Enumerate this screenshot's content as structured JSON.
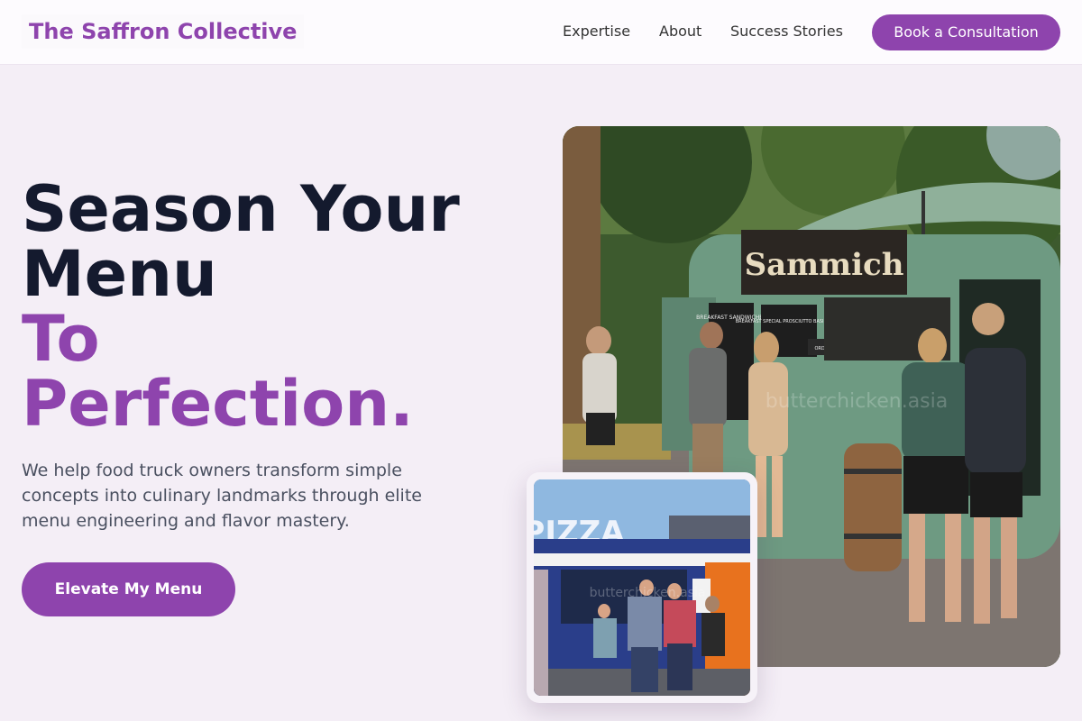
{
  "header": {
    "brand": "The Saffron Collective",
    "nav": [
      "Expertise",
      "About",
      "Success Stories"
    ],
    "cta": "Book a Consultation"
  },
  "hero": {
    "headline_line1": "Season Your",
    "headline_line2": "Menu",
    "headline_line3": "To",
    "headline_line4": "Perfection.",
    "subtext": "We help food truck owners transform simple concepts into culinary landmarks through elite menu engineering and flavor mastery.",
    "cta": "Elevate My Menu"
  },
  "images": {
    "main_sign": "Sammich",
    "main_board1": "BREAKFAST SANDWICHES",
    "main_board2": "BREAKFAST SPECIAL PROSCIUTTO BASIL PESTO",
    "main_board3": "ORDER HERE",
    "main_watermark": "butterchicken.asia",
    "inset_sign": "PIZZA",
    "inset_watermark": "butterchicken.asia"
  },
  "colors": {
    "accent": "#8e44ad",
    "heading": "#141a2e",
    "background": "#f4eef6"
  }
}
